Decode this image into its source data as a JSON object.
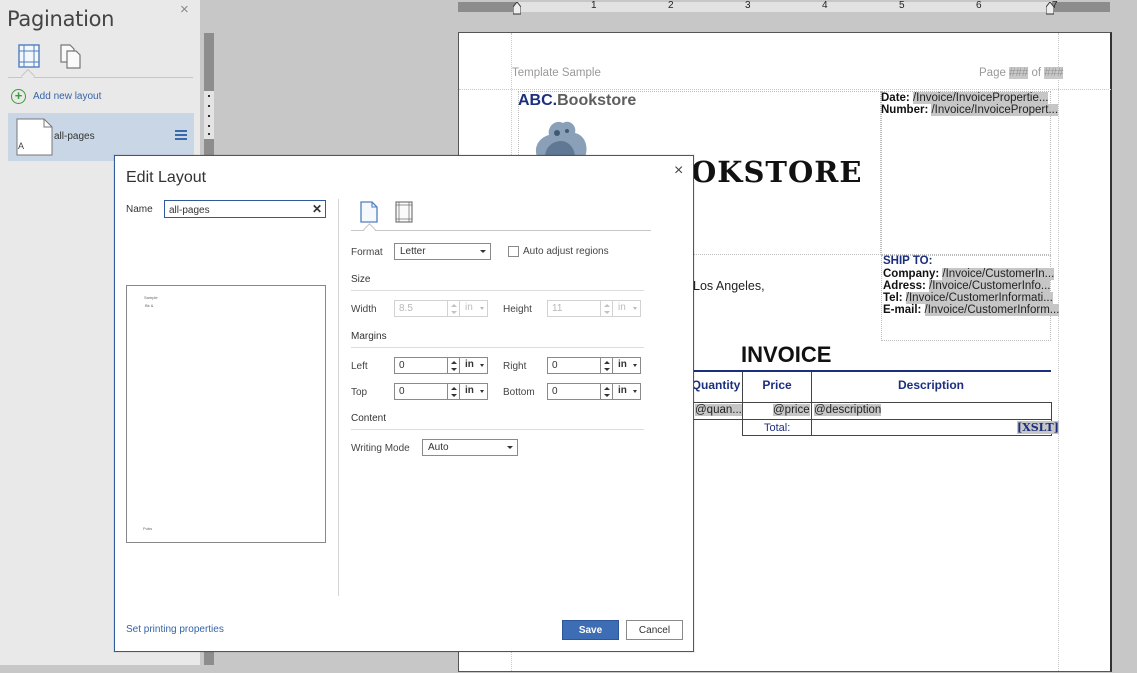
{
  "pagination": {
    "title": "Pagination",
    "close_glyph": "×",
    "view_icons": [
      "single-page-table-icon",
      "multi-page-icon"
    ],
    "add_layout_label": "Add new layout",
    "layouts": [
      {
        "label": "all-pages",
        "thumb_letter": "A"
      }
    ]
  },
  "ruler": {
    "numbers": [
      "1",
      "2",
      "3",
      "4",
      "5",
      "6",
      "7"
    ]
  },
  "document": {
    "header_left": "Template Sample",
    "header_right_prefix": "Page ",
    "header_right_page": "###",
    "header_right_mid": " of ",
    "header_right_total": "###",
    "brand_abc": "ABC.",
    "brand_bookstore": "Bookstore",
    "big_name": "OKSTORE",
    "date_label": "Date: ",
    "date_xpath": "/Invoice/InvoicePropertie...",
    "number_label": "Number: ",
    "number_xpath": "/Invoice/InvoicePropert...",
    "ship_to": "SHIP TO:",
    "company_label": "Company: ",
    "company_xpath": "/Invoice/CustomerIn...",
    "adress_label": "Adress: ",
    "adress_xpath": "/Invoice/CustomerInfo...",
    "tel_label": "Tel: ",
    "tel_xpath": "/Invoice/CustomerInformati...",
    "email_label": "E-mail: ",
    "email_xpath": "/Invoice/CustomerInform...",
    "address_text": "Los Angeles,",
    "invoice_title": "INVOICE",
    "col_quantity": "Quantity",
    "col_price": "Price",
    "col_description": "Description",
    "cell_quantity": "@quan...",
    "cell_price": "@price",
    "cell_description": "@description",
    "total_label": "Total:",
    "xslt_label": "[XSLT]",
    "colors": {
      "brand_blue": "#1c2f7e",
      "placeholder_gray": "#c6c6c6"
    }
  },
  "dialog": {
    "title": "Edit Layout",
    "close_glyph": "×",
    "name_label": "Name",
    "name_value": "all-pages",
    "name_clear_glyph": "✕",
    "preview": {
      "header_left": "Sample",
      "header_line": "Bk &",
      "footer": "Pubs"
    },
    "tabs": [
      "page-format-icon",
      "margins-icon"
    ],
    "format_label": "Format",
    "format_value": "Letter",
    "auto_adjust_label": "Auto adjust regions",
    "size_heading": "Size",
    "width_label": "Width",
    "width_value": "8.5",
    "width_unit": "in",
    "height_label": "Height",
    "height_value": "11",
    "height_unit": "in",
    "margins_heading": "Margins",
    "left_label": "Left",
    "left_value": "0",
    "left_unit": "in",
    "right_label": "Right",
    "right_value": "0",
    "right_unit": "in",
    "top_label": "Top",
    "top_value": "0",
    "top_unit": "in",
    "bottom_label": "Bottom",
    "bottom_value": "0",
    "bottom_unit": "in",
    "content_heading": "Content",
    "writing_mode_label": "Writing Mode",
    "writing_mode_value": "Auto",
    "set_printing_link": "Set printing properties",
    "save_label": "Save",
    "cancel_label": "Cancel",
    "colors": {
      "accent": "#3d6db5",
      "border": "#2f5a9b",
      "link": "#3564a8"
    }
  }
}
